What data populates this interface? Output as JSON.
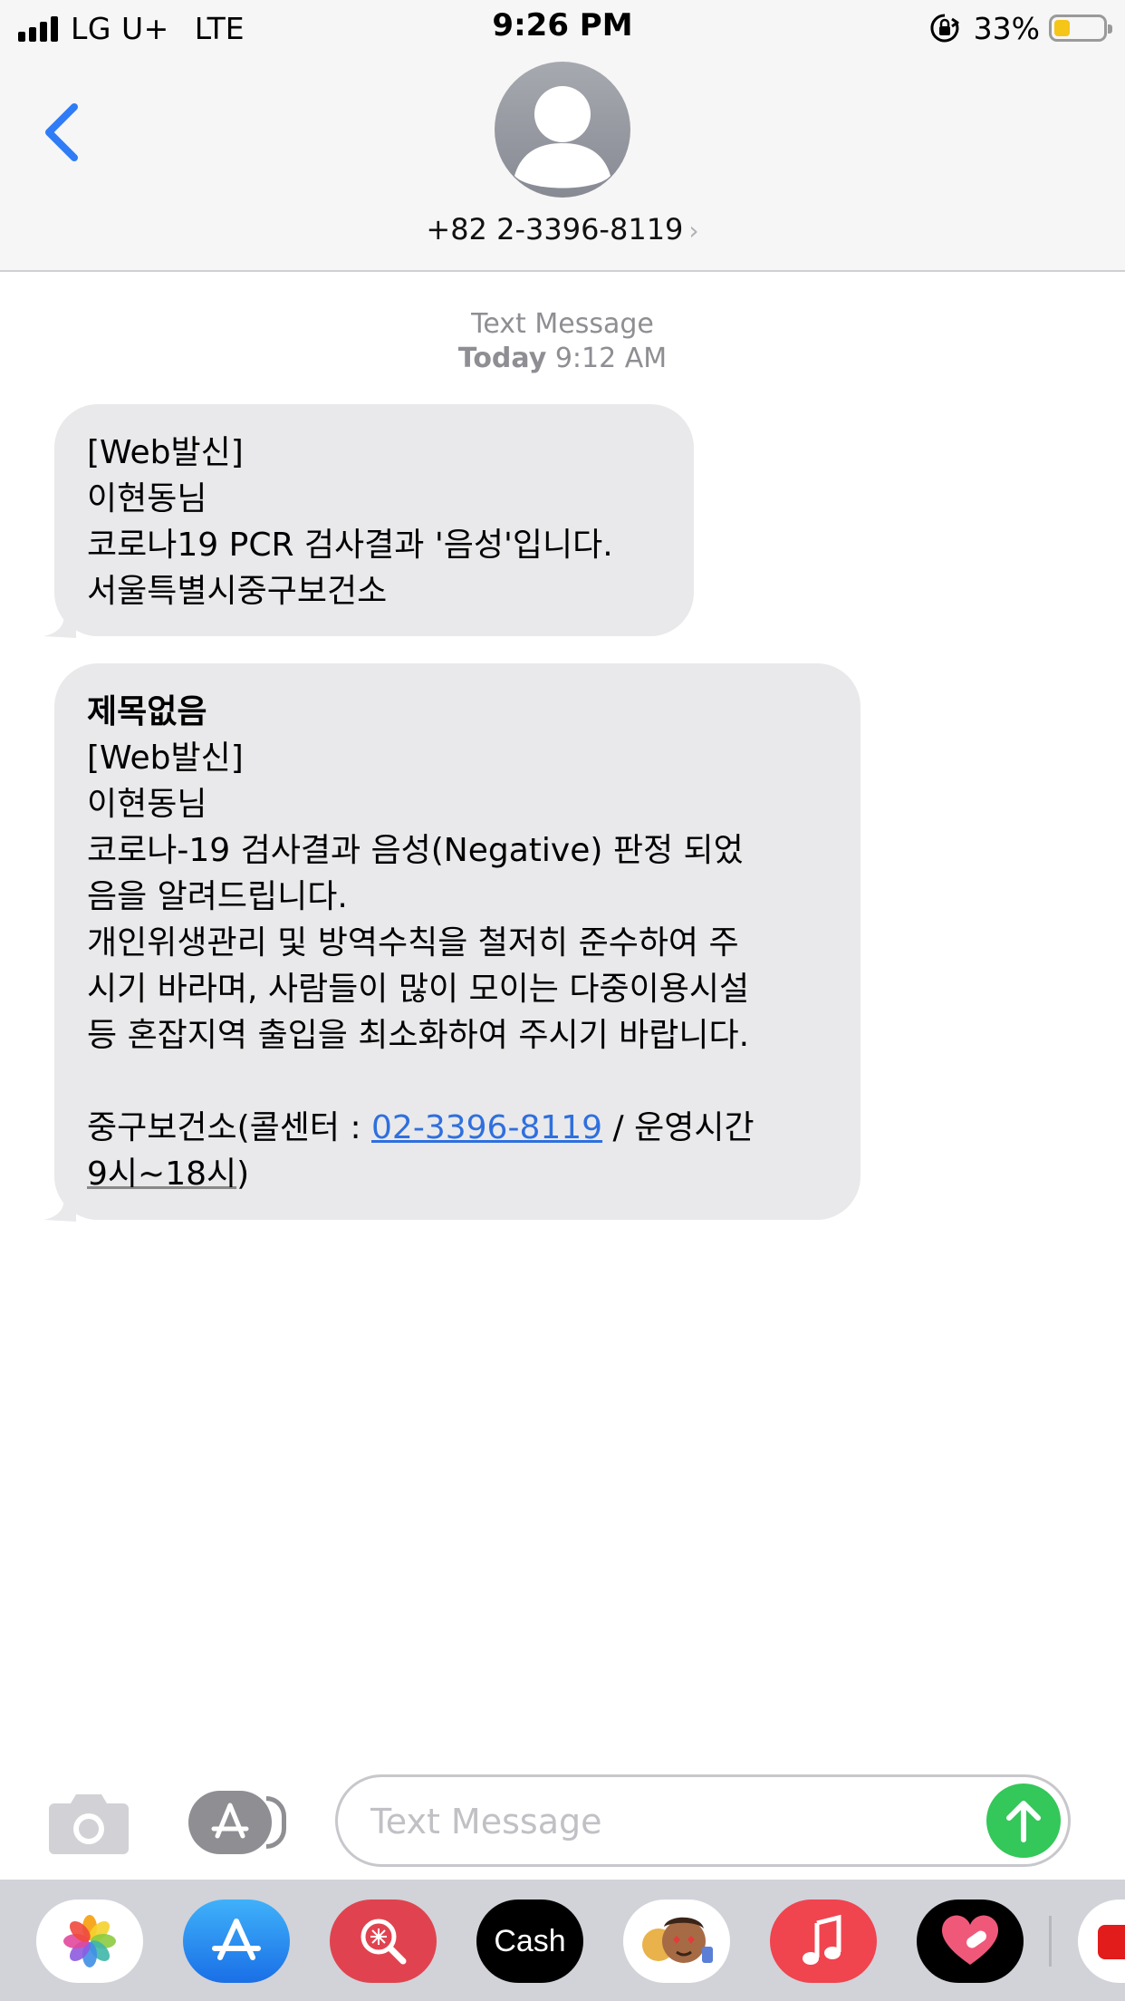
{
  "status_bar": {
    "carrier": "LG U+",
    "network": "LTE",
    "time": "9:26 PM",
    "battery_percent": "33%",
    "battery_level": 0.33,
    "icons": [
      "signal-icon",
      "rotation-lock-icon",
      "battery-icon"
    ]
  },
  "header": {
    "back_icon": "chevron-left-icon",
    "avatar_icon": "person-silhouette-icon",
    "contact": "+82 2-3396-8119",
    "contact_chevron": "›"
  },
  "conversation": {
    "kind": "Text Message",
    "day": "Today",
    "time": "9:12 AM",
    "messages": [
      {
        "lines": [
          "[Web발신]",
          "이현동님",
          "코로나19 PCR 검사결과 '음성'입니다.",
          "서울특별시중구보건소"
        ]
      },
      {
        "subject": "제목없음",
        "lines": [
          "[Web발신]",
          "이현동님",
          "코로나-19 검사결과 음성(Negative) 판정 되었",
          "음을 알려드립니다.",
          "개인위생관리 및 방역수칙을 철저히 준수하여 주",
          "시기 바라며, 사람들이 많이 모이는 다중이용시설",
          "등 혼잡지역 출입을 최소화하여 주시기 바랍니다."
        ],
        "footer_prefix": "중구보건소(콜센터 : ",
        "footer_phone": "02-3396-8119",
        "footer_suffix": " / 운영시간",
        "footer_hours": "9시~18시",
        "footer_close": ")"
      }
    ]
  },
  "compose": {
    "camera_icon": "camera-icon",
    "apps_icon": "app-store-icon",
    "placeholder": "Text Message",
    "send_icon": "arrow-up-icon"
  },
  "app_drawer": {
    "apps": [
      "photos-icon",
      "app-store-icon",
      "web-search-icon",
      "apple-cash-icon",
      "memoji-icon",
      "music-icon",
      "heart-app-icon"
    ],
    "cash_label": "Cash",
    "cash_logo": ""
  },
  "colors": {
    "link": "#2f6fde",
    "bubble": "#e9e9eb",
    "send": "#34c759",
    "back": "#2f7cf6"
  }
}
